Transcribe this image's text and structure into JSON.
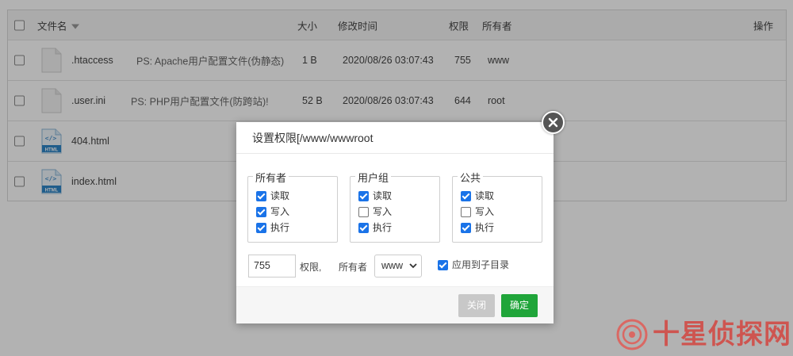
{
  "table": {
    "headers": {
      "name": "文件名",
      "size": "大小",
      "modified": "修改时间",
      "perms": "权限",
      "owner": "所有者",
      "actions": "操作"
    },
    "rows": [
      {
        "name": ".htaccess",
        "ps": "PS: Apache用户配置文件(伪静态)",
        "size": "1 B",
        "modified": "2020/08/26 03:07:43",
        "perms": "755",
        "owner": "www",
        "icon": "file-icon"
      },
      {
        "name": ".user.ini",
        "ps": "PS: PHP用户配置文件(防跨站)!",
        "size": "52 B",
        "modified": "2020/08/26 03:07:43",
        "perms": "644",
        "owner": "root",
        "icon": "file-icon"
      },
      {
        "name": "404.html",
        "icon": "html-file-icon",
        "icon_label": "HTML"
      },
      {
        "name": "index.html",
        "icon": "html-file-icon",
        "icon_label": "HTML"
      }
    ]
  },
  "dialog": {
    "title": "设置权限[/www/wwwroot",
    "groups": [
      {
        "legend": "所有者",
        "perms": [
          {
            "label": "读取",
            "checked": true
          },
          {
            "label": "写入",
            "checked": true
          },
          {
            "label": "执行",
            "checked": true
          }
        ]
      },
      {
        "legend": "用户组",
        "perms": [
          {
            "label": "读取",
            "checked": true
          },
          {
            "label": "写入",
            "checked": false
          },
          {
            "label": "执行",
            "checked": true
          }
        ]
      },
      {
        "legend": "公共",
        "perms": [
          {
            "label": "读取",
            "checked": true
          },
          {
            "label": "写入",
            "checked": false
          },
          {
            "label": "执行",
            "checked": true
          }
        ]
      }
    ],
    "mode_value": "755",
    "perms_label": "权限,",
    "owner_label": "所有者",
    "owner_selected": "www",
    "apply_subdirs_label": "应用到子目录",
    "apply_subdirs_checked": true,
    "close_button": "关闭",
    "ok_button": "确定"
  },
  "watermark": {
    "text": "十星侦探网"
  },
  "colors": {
    "accent_blue": "#1a73e8",
    "ok_green": "#20a53a",
    "watermark_red": "#d4453f"
  }
}
